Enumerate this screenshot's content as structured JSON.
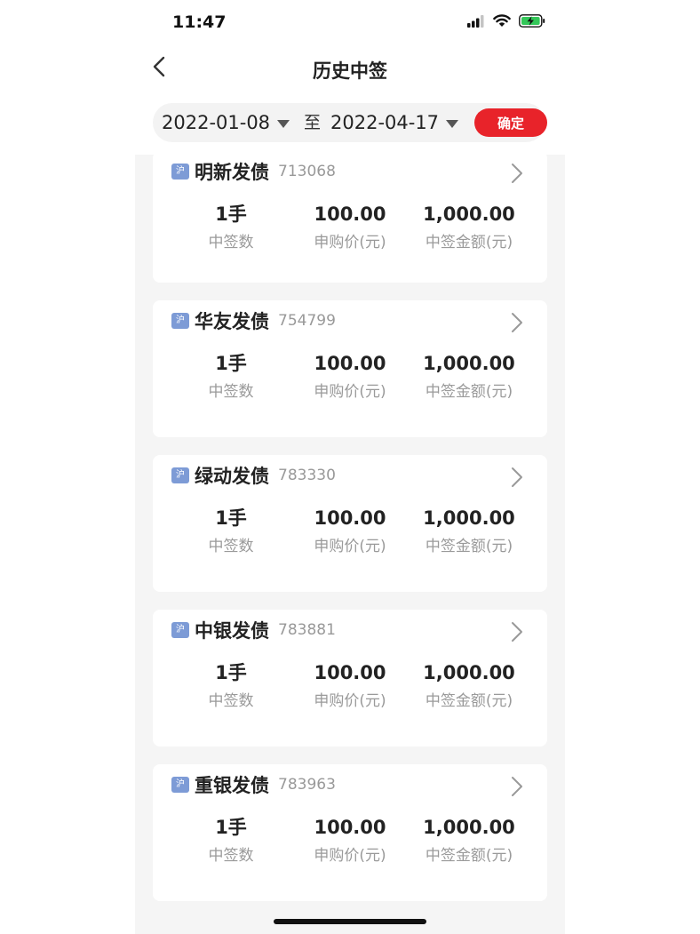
{
  "status_bar": {
    "time": "11:47"
  },
  "nav": {
    "title": "历史中签"
  },
  "filter": {
    "start_date": "2022-01-08",
    "separator": "至",
    "end_date": "2022-04-17",
    "confirm_label": "确定"
  },
  "labels": {
    "count": "中签数",
    "price": "申购价(元)",
    "amount": "中签金额(元)"
  },
  "records": [
    {
      "exchange": "沪",
      "name": "明新发债",
      "code": "713068",
      "count": "1手",
      "price": "100.00",
      "amount": "1,000.00"
    },
    {
      "exchange": "沪",
      "name": "华友发债",
      "code": "754799",
      "count": "1手",
      "price": "100.00",
      "amount": "1,000.00"
    },
    {
      "exchange": "沪",
      "name": "绿动发债",
      "code": "783330",
      "count": "1手",
      "price": "100.00",
      "amount": "1,000.00"
    },
    {
      "exchange": "沪",
      "name": "中银发债",
      "code": "783881",
      "count": "1手",
      "price": "100.00",
      "amount": "1,000.00"
    },
    {
      "exchange": "沪",
      "name": "重银发债",
      "code": "783963",
      "count": "1手",
      "price": "100.00",
      "amount": "1,000.00"
    }
  ],
  "colors": {
    "accent": "#e8232a",
    "badge": "#7d9bd6",
    "background": "#f5f5f5"
  },
  "icons": [
    "signal-icon",
    "wifi-icon",
    "battery-charging-icon",
    "back-chevron-icon",
    "dropdown-caret-icon",
    "chevron-right-icon"
  ]
}
